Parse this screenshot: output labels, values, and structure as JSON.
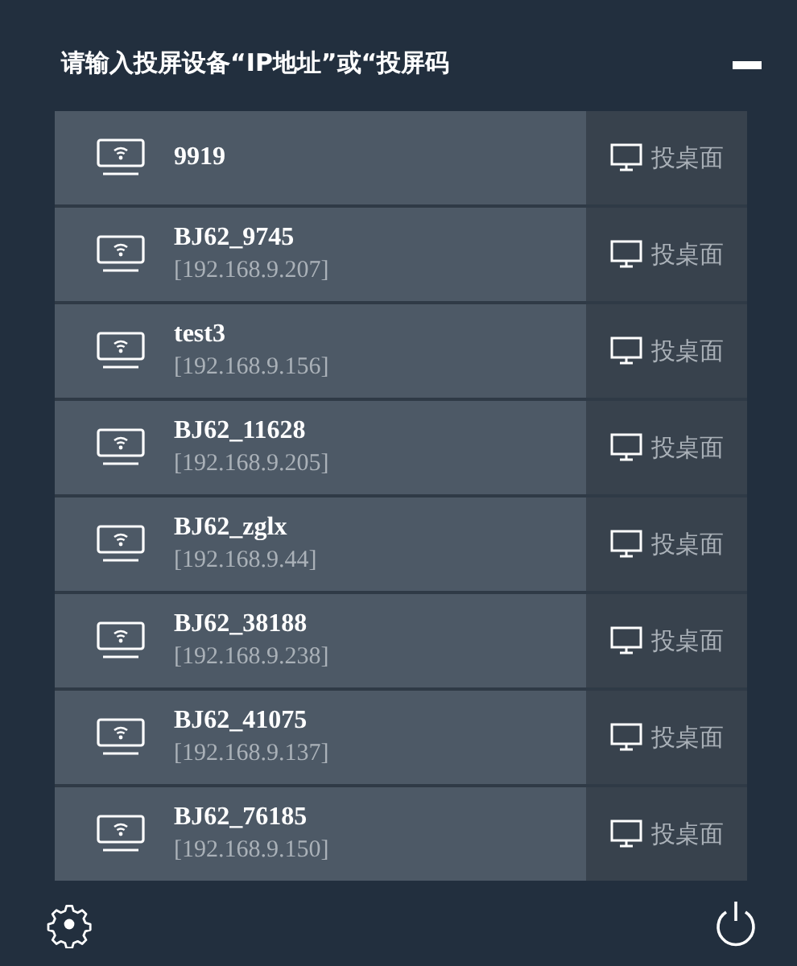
{
  "title": "请输入投屏设备“IP地址”或“投屏码",
  "devices": [
    {
      "name": "9919",
      "action_label": "投桌面"
    },
    {
      "name": "BJ62_9745",
      "address": "[192.168.9.207]",
      "action_label": "投桌面"
    },
    {
      "name": "test3",
      "address": "[192.168.9.156]",
      "action_label": "投桌面"
    },
    {
      "name": "BJ62_11628",
      "address": "[192.168.9.205]",
      "action_label": "投桌面"
    },
    {
      "name": "BJ62_zglx",
      "address": "[192.168.9.44]",
      "action_label": "投桌面"
    },
    {
      "name": "BJ62_38188",
      "address": "[192.168.9.238]",
      "action_label": "投桌面"
    },
    {
      "name": "BJ62_41075",
      "address": "[192.168.9.137]",
      "action_label": "投桌面"
    },
    {
      "name": "BJ62_76185",
      "address": "[192.168.9.150]",
      "action_label": "投桌面"
    }
  ]
}
